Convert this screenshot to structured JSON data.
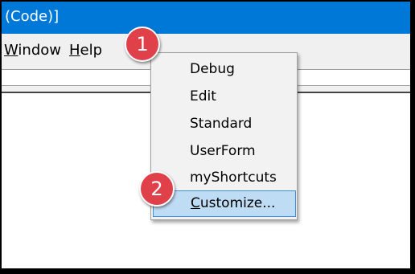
{
  "window": {
    "title_fragment": "(Code)]"
  },
  "menubar": {
    "window_accel": "W",
    "window_rest": "indow",
    "help_accel": "H",
    "help_rest": "elp"
  },
  "context_menu": {
    "items": [
      {
        "label": "Debug"
      },
      {
        "label": "Edit"
      },
      {
        "label": "Standard"
      },
      {
        "label": "UserForm"
      },
      {
        "label": "myShortcuts"
      }
    ],
    "customize_accel": "C",
    "customize_rest": "ustomize..."
  },
  "callouts": {
    "step1": "1",
    "step2": "2"
  },
  "colors": {
    "titlebar": "#0078d7",
    "menu_highlight": "#bfdcf5",
    "callout": "#e0404a"
  }
}
